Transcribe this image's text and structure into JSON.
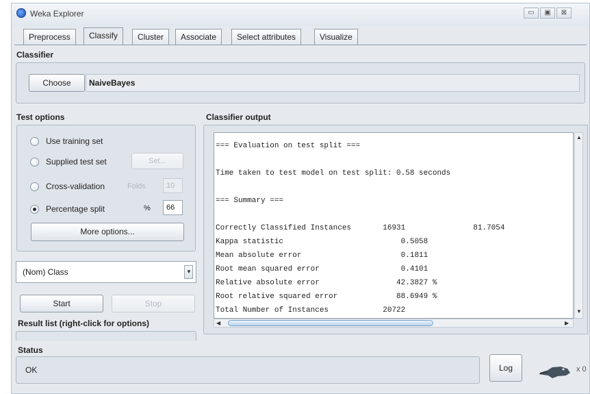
{
  "window": {
    "title": "Weka Explorer",
    "controls": [
      "▭",
      "▣",
      "⊠"
    ]
  },
  "tabs": [
    "Preprocess",
    "Classify",
    "Cluster",
    "Associate",
    "Select attributes",
    "Visualize"
  ],
  "active_tab": "Classify",
  "classifier": {
    "section_label": "Classifier",
    "choose_label": "Choose",
    "name": "NaiveBayes"
  },
  "test_options": {
    "section_label": "Test options",
    "use_training_set": "Use training set",
    "supplied_test_set": "Supplied test set",
    "set_button": "Set...",
    "cross_validation": "Cross-validation",
    "folds_label": "Folds",
    "folds_value": "10",
    "percentage_split": "Percentage split",
    "percent_symbol": "%",
    "percentage_value": "66",
    "selected": "Percentage split",
    "more_options": "More options..."
  },
  "class_select": {
    "value": "(Nom) Class"
  },
  "actions": {
    "start": "Start",
    "stop": "Stop"
  },
  "result_list": {
    "label": "Result list (right-click for options)"
  },
  "output": {
    "section_label": "Classifier output",
    "lines": [
      "=== Evaluation on test split ===",
      "",
      "Time taken to test model on test split: 0.58 seconds",
      "",
      "=== Summary ===",
      "",
      "Correctly Classified Instances       16931               81.7054",
      "Kappa statistic                          0.5058",
      "Mean absolute error                      0.1811",
      "Root mean squared error                  0.4101",
      "Relative absolute error                 42.3827 %",
      "Root relative squared error             88.6949 %",
      "Total Number of Instances            20722"
    ]
  },
  "status": {
    "section_label": "Status",
    "text": "OK",
    "log_button": "Log",
    "count": "x 0"
  }
}
